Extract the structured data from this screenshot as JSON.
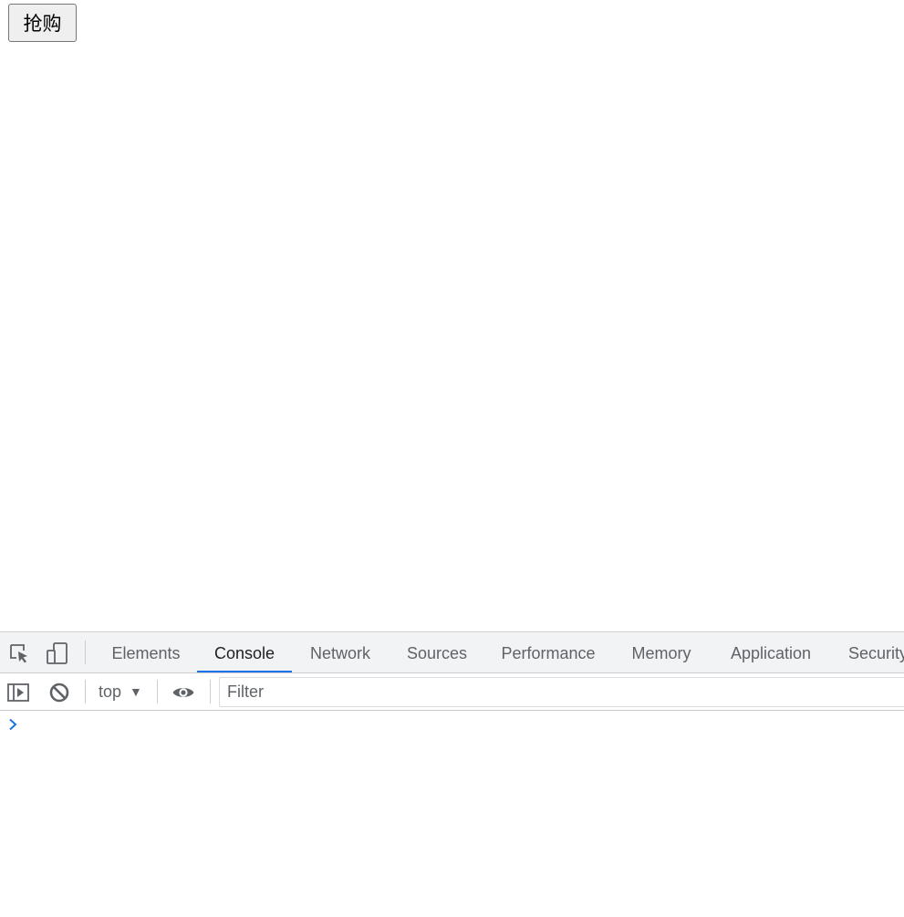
{
  "page": {
    "buy_button_label": "抢购"
  },
  "devtools": {
    "tabs": [
      {
        "label": "Elements",
        "active": false
      },
      {
        "label": "Console",
        "active": true
      },
      {
        "label": "Network",
        "active": false
      },
      {
        "label": "Sources",
        "active": false
      },
      {
        "label": "Performance",
        "active": false
      },
      {
        "label": "Memory",
        "active": false
      },
      {
        "label": "Application",
        "active": false
      },
      {
        "label": "Security",
        "active": false
      }
    ],
    "toolbar_icons": {
      "inspect": "inspect-element-icon",
      "device": "device-toolbar-icon",
      "sidebar": "show-sidebar-icon",
      "clear": "clear-console-icon",
      "live_expression": "eye-icon",
      "prompt": "chevron-right-icon"
    },
    "context_label": "top",
    "context_arrow": "▼",
    "filter_placeholder": "Filter",
    "filter_value": "",
    "accent_color": "#1a73e8"
  }
}
